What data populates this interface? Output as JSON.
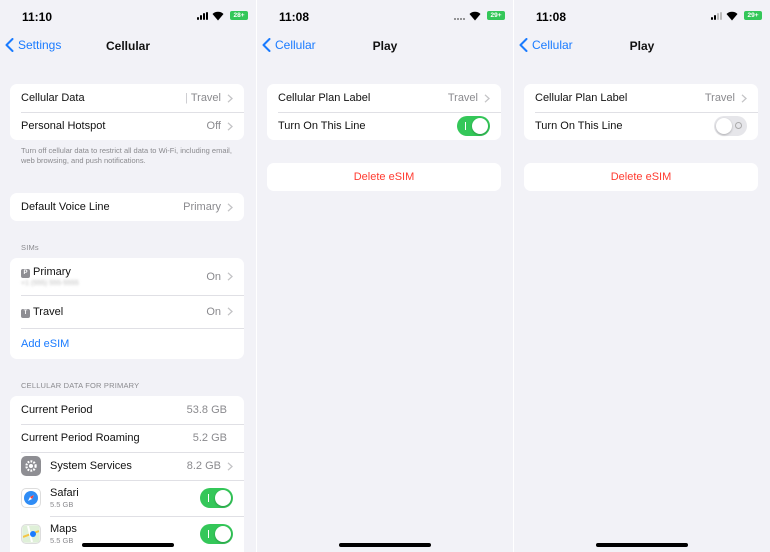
{
  "screen1": {
    "time": "11:10",
    "battery": "28+",
    "back_label": "Settings",
    "title": "Cellular",
    "group1": [
      {
        "label": "Cellular Data",
        "value": "Travel"
      },
      {
        "label": "Personal Hotspot",
        "value": "Off"
      }
    ],
    "footnote": "Turn off cellular data to restrict all data to Wi-Fi, including email, web browsing, and push notifications.",
    "voice_line": {
      "label": "Default Voice Line",
      "value": "Primary"
    },
    "sims_header": "SIMs",
    "sims": [
      {
        "badge": "P",
        "label": "Primary",
        "number": "+1 (555) 555-5555",
        "value": "On"
      },
      {
        "badge": "T",
        "label": "Travel",
        "value": "On"
      }
    ],
    "add_esim": "Add eSIM",
    "usage_header": "CELLULAR DATA FOR PRIMARY",
    "usage": [
      {
        "label": "Current Period",
        "value": "53.8 GB"
      },
      {
        "label": "Current Period Roaming",
        "value": "5.2 GB"
      }
    ],
    "apps": [
      {
        "icon": "gear-icon",
        "label": "System Services",
        "value": "8.2 GB"
      },
      {
        "icon": "safari-icon",
        "label": "Safari",
        "size": "5.5 GB",
        "enabled": true
      },
      {
        "icon": "maps-icon",
        "label": "Maps",
        "size": "5.5 GB",
        "enabled": true
      }
    ]
  },
  "screen2": {
    "time": "11:08",
    "battery": "29+",
    "back_label": "Cellular",
    "title": "Play",
    "plan_label": {
      "label": "Cellular Plan Label",
      "value": "Travel"
    },
    "turn_on_line": {
      "label": "Turn On This Line",
      "enabled": true
    },
    "delete_label": "Delete eSIM"
  },
  "screen3": {
    "time": "11:08",
    "battery": "29+",
    "back_label": "Cellular",
    "title": "Play",
    "plan_label": {
      "label": "Cellular Plan Label",
      "value": "Travel"
    },
    "turn_on_line": {
      "label": "Turn On This Line",
      "enabled": false
    },
    "delete_label": "Delete eSIM"
  },
  "colors": {
    "accent": "#1a7bff",
    "toggle_on": "#34c759",
    "destructive": "#ff3b30",
    "background": "#f2f2f7"
  }
}
